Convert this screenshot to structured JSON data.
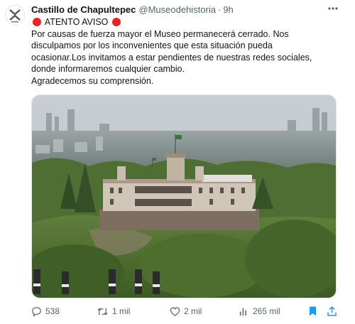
{
  "tweet": {
    "author_name": "Castillo de Chapultepec",
    "handle": "@Museodehistoria",
    "separator": "·",
    "time": "9h",
    "text_heading": "ATENTO AVISO",
    "text_lines": [
      "Por causas de fuerza mayor el Museo permanecerá cerrado. Nos",
      "disculpamos por los inconvenientes que esta situación pueda",
      "ocasionar.Los invitamos a estar pendientes de nuestras redes sociales,",
      "donde informaremos cualquier cambio.",
      "Agradecemos su comprensión."
    ]
  },
  "actions": {
    "replies": "538",
    "reposts": "1 mil",
    "likes": "2 mil",
    "views": "265 mil"
  },
  "colors": {
    "accent": "#1d9bf0",
    "alert_red": "#e32525",
    "muted": "#536471"
  }
}
